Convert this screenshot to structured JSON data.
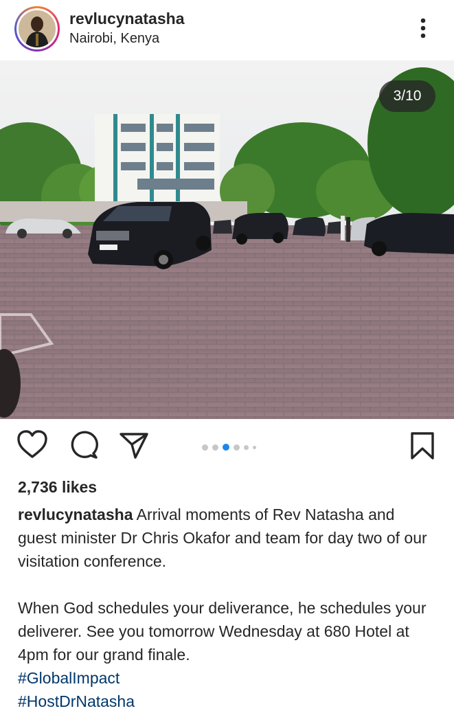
{
  "post": {
    "username": "revlucynatasha",
    "location": "Nairobi, Kenya",
    "counter": "3/10",
    "likes": "2,736 likes",
    "caption": {
      "username": "revlucynatasha",
      "line1": "Arrival moments of Rev Natasha and guest minister Dr Chris Okafor and team for day two of our visitation conference.",
      "line2": "When God schedules your deliverance, he schedules your deliverer. See you tomorrow Wednesday at 680 Hotel at 4pm for our grand finale.",
      "hashtags": [
        "#GlobalImpact",
        "#HostDrNatasha"
      ]
    },
    "carousel": {
      "current": 3,
      "total_dots_visible": 6
    }
  },
  "icons": {
    "more": "more-vertical-icon",
    "like": "heart-icon",
    "comment": "comment-icon",
    "share": "share-icon",
    "save": "bookmark-icon"
  },
  "colors": {
    "accent": "#1c86ee",
    "hashtag": "#00376b",
    "text": "#262626"
  }
}
